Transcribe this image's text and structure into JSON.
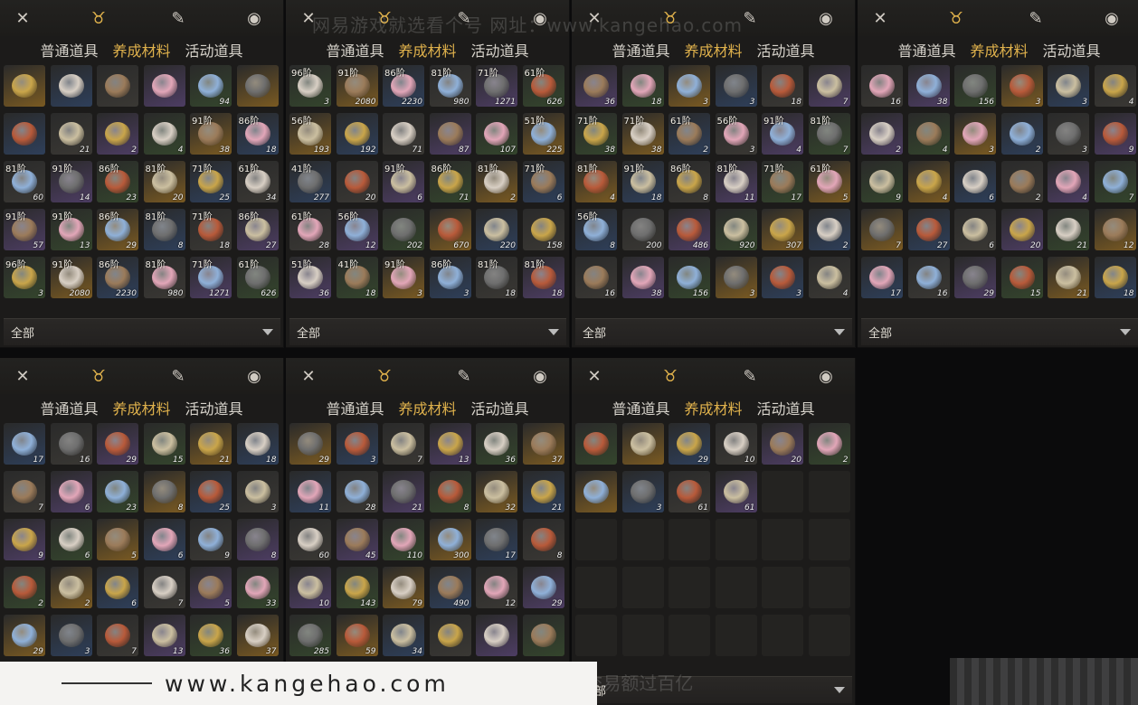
{
  "tabs_categories": [
    "普通道具",
    "养成材料",
    "活动道具"
  ],
  "active_category": "养成材料",
  "filter_label": "全部",
  "watermark_top": "网易游戏就选看个号  网址：www.kangehao.com",
  "watermark_bottom": "看个号专业网易游戏八年   年交易额过百亿",
  "banner_url": "www.kangehao.com",
  "top_icons": [
    "crossed-swords-icon",
    "pouch-icon",
    "scroll-icon",
    "location-pin-icon"
  ],
  "panels": [
    {
      "cells": [
        {
          "r": "",
          "q": ""
        },
        {
          "r": "",
          "q": ""
        },
        {
          "r": "",
          "q": ""
        },
        {
          "r": "",
          "q": ""
        },
        {
          "r": "",
          "q": "94"
        },
        {
          "r": "",
          "q": ""
        },
        {
          "r": "",
          "q": ""
        },
        {
          "r": "",
          "q": "21"
        },
        {
          "r": "",
          "q": "2"
        },
        {
          "r": "",
          "q": "4"
        },
        {
          "r": "91阶",
          "q": "38"
        },
        {
          "r": "86阶",
          "q": "18"
        },
        {
          "r": "81阶",
          "q": "60"
        },
        {
          "r": "91阶",
          "q": "14"
        },
        {
          "r": "86阶",
          "q": "23"
        },
        {
          "r": "81阶",
          "q": "20"
        },
        {
          "r": "71阶",
          "q": "25"
        },
        {
          "r": "61阶",
          "q": "34"
        },
        {
          "r": "91阶",
          "q": "57"
        },
        {
          "r": "91阶",
          "q": "13"
        },
        {
          "r": "86阶",
          "q": "29"
        },
        {
          "r": "81阶",
          "q": "8"
        },
        {
          "r": "71阶",
          "q": "18"
        },
        {
          "r": "86阶",
          "q": "27"
        },
        {
          "r": "96阶",
          "q": "3"
        },
        {
          "r": "91阶",
          "q": "2080"
        },
        {
          "r": "86阶",
          "q": "2230"
        },
        {
          "r": "81阶",
          "q": "980"
        },
        {
          "r": "71阶",
          "q": "1271"
        },
        {
          "r": "61阶",
          "q": "626"
        }
      ]
    },
    {
      "cells": [
        {
          "r": "96阶",
          "q": "3"
        },
        {
          "r": "91阶",
          "q": "2080"
        },
        {
          "r": "86阶",
          "q": "2230"
        },
        {
          "r": "81阶",
          "q": "980"
        },
        {
          "r": "71阶",
          "q": "1271"
        },
        {
          "r": "61阶",
          "q": "626"
        },
        {
          "r": "56阶",
          "q": "193"
        },
        {
          "r": "",
          "q": "192"
        },
        {
          "r": "",
          "q": "71"
        },
        {
          "r": "",
          "q": "87"
        },
        {
          "r": "",
          "q": "107"
        },
        {
          "r": "51阶",
          "q": "225"
        },
        {
          "r": "41阶",
          "q": "277"
        },
        {
          "r": "",
          "q": "20"
        },
        {
          "r": "91阶",
          "q": "6"
        },
        {
          "r": "86阶",
          "q": "71"
        },
        {
          "r": "81阶",
          "q": "2"
        },
        {
          "r": "71阶",
          "q": "6"
        },
        {
          "r": "61阶",
          "q": "28"
        },
        {
          "r": "56阶",
          "q": "12"
        },
        {
          "r": "",
          "q": "202"
        },
        {
          "r": "",
          "q": "670"
        },
        {
          "r": "",
          "q": "220"
        },
        {
          "r": "",
          "q": "158"
        },
        {
          "r": "51阶",
          "q": "36"
        },
        {
          "r": "41阶",
          "q": "18"
        },
        {
          "r": "91阶",
          "q": "3"
        },
        {
          "r": "86阶",
          "q": "3"
        },
        {
          "r": "81阶",
          "q": "18"
        },
        {
          "r": "81阶",
          "q": "18"
        }
      ]
    },
    {
      "cells": [
        {
          "r": "",
          "q": "36"
        },
        {
          "r": "",
          "q": "18"
        },
        {
          "r": "",
          "q": "3"
        },
        {
          "r": "",
          "q": "3"
        },
        {
          "r": "",
          "q": "18"
        },
        {
          "r": "",
          "q": "7"
        },
        {
          "r": "71阶",
          "q": "38"
        },
        {
          "r": "71阶",
          "q": "38"
        },
        {
          "r": "61阶",
          "q": "2"
        },
        {
          "r": "56阶",
          "q": "3"
        },
        {
          "r": "91阶",
          "q": "4"
        },
        {
          "r": "81阶",
          "q": "7"
        },
        {
          "r": "81阶",
          "q": "4"
        },
        {
          "r": "91阶",
          "q": "18"
        },
        {
          "r": "86阶",
          "q": "8"
        },
        {
          "r": "81阶",
          "q": "11"
        },
        {
          "r": "71阶",
          "q": "17"
        },
        {
          "r": "61阶",
          "q": "5"
        },
        {
          "r": "56阶",
          "q": "8"
        },
        {
          "r": "",
          "q": "200"
        },
        {
          "r": "",
          "q": "486"
        },
        {
          "r": "",
          "q": "920"
        },
        {
          "r": "",
          "q": "307"
        },
        {
          "r": "",
          "q": "2"
        },
        {
          "r": "",
          "q": "16"
        },
        {
          "r": "",
          "q": "38"
        },
        {
          "r": "",
          "q": "156"
        },
        {
          "r": "",
          "q": "3"
        },
        {
          "r": "",
          "q": "3"
        },
        {
          "r": "",
          "q": "4"
        }
      ]
    },
    {
      "cells": [
        {
          "r": "",
          "q": "16"
        },
        {
          "r": "",
          "q": "38"
        },
        {
          "r": "",
          "q": "156"
        },
        {
          "r": "",
          "q": "3"
        },
        {
          "r": "",
          "q": "3"
        },
        {
          "r": "",
          "q": "4"
        },
        {
          "r": "",
          "q": "2"
        },
        {
          "r": "",
          "q": "4"
        },
        {
          "r": "",
          "q": "3"
        },
        {
          "r": "",
          "q": "2"
        },
        {
          "r": "",
          "q": "3"
        },
        {
          "r": "",
          "q": "9"
        },
        {
          "r": "",
          "q": "9"
        },
        {
          "r": "",
          "q": "4"
        },
        {
          "r": "",
          "q": "6"
        },
        {
          "r": "",
          "q": "2"
        },
        {
          "r": "",
          "q": "4"
        },
        {
          "r": "",
          "q": "7"
        },
        {
          "r": "",
          "q": "7"
        },
        {
          "r": "",
          "q": "27"
        },
        {
          "r": "",
          "q": "6"
        },
        {
          "r": "",
          "q": "20"
        },
        {
          "r": "",
          "q": "21"
        },
        {
          "r": "",
          "q": "12"
        },
        {
          "r": "",
          "q": "17"
        },
        {
          "r": "",
          "q": "16"
        },
        {
          "r": "",
          "q": "29"
        },
        {
          "r": "",
          "q": "15"
        },
        {
          "r": "",
          "q": "21"
        },
        {
          "r": "",
          "q": "18"
        }
      ]
    },
    {
      "cells": [
        {
          "r": "",
          "q": "17"
        },
        {
          "r": "",
          "q": "16"
        },
        {
          "r": "",
          "q": "29"
        },
        {
          "r": "",
          "q": "15"
        },
        {
          "r": "",
          "q": "21"
        },
        {
          "r": "",
          "q": "18"
        },
        {
          "r": "",
          "q": "7"
        },
        {
          "r": "",
          "q": "6"
        },
        {
          "r": "",
          "q": "23"
        },
        {
          "r": "",
          "q": "8"
        },
        {
          "r": "",
          "q": "25"
        },
        {
          "r": "",
          "q": "3"
        },
        {
          "r": "",
          "q": "9"
        },
        {
          "r": "",
          "q": "6"
        },
        {
          "r": "",
          "q": "5"
        },
        {
          "r": "",
          "q": "6"
        },
        {
          "r": "",
          "q": "9"
        },
        {
          "r": "",
          "q": "8"
        },
        {
          "r": "",
          "q": "2"
        },
        {
          "r": "",
          "q": "2"
        },
        {
          "r": "",
          "q": "6"
        },
        {
          "r": "",
          "q": "7"
        },
        {
          "r": "",
          "q": "5"
        },
        {
          "r": "",
          "q": "33"
        },
        {
          "r": "",
          "q": "29"
        },
        {
          "r": "",
          "q": "3"
        },
        {
          "r": "",
          "q": "7"
        },
        {
          "r": "",
          "q": "13"
        },
        {
          "r": "",
          "q": "36"
        },
        {
          "r": "",
          "q": "37"
        }
      ]
    },
    {
      "cells": [
        {
          "r": "",
          "q": "29"
        },
        {
          "r": "",
          "q": "3"
        },
        {
          "r": "",
          "q": "7"
        },
        {
          "r": "",
          "q": "13"
        },
        {
          "r": "",
          "q": "36"
        },
        {
          "r": "",
          "q": "37"
        },
        {
          "r": "",
          "q": "11"
        },
        {
          "r": "",
          "q": "28"
        },
        {
          "r": "",
          "q": "21"
        },
        {
          "r": "",
          "q": "8"
        },
        {
          "r": "",
          "q": "32"
        },
        {
          "r": "",
          "q": "21"
        },
        {
          "r": "",
          "q": "60"
        },
        {
          "r": "",
          "q": "45"
        },
        {
          "r": "",
          "q": "110"
        },
        {
          "r": "",
          "q": "300"
        },
        {
          "r": "",
          "q": "17"
        },
        {
          "r": "",
          "q": "8"
        },
        {
          "r": "",
          "q": "10"
        },
        {
          "r": "",
          "q": "143"
        },
        {
          "r": "",
          "q": "79"
        },
        {
          "r": "",
          "q": "490"
        },
        {
          "r": "",
          "q": "12"
        },
        {
          "r": "",
          "q": "29"
        },
        {
          "r": "",
          "q": "285"
        },
        {
          "r": "",
          "q": "59"
        },
        {
          "r": "",
          "q": "34"
        },
        {
          "r": "",
          "q": ""
        },
        {
          "r": "",
          "q": ""
        },
        {
          "r": "",
          "q": ""
        }
      ]
    },
    {
      "cells": [
        {
          "r": "",
          "q": ""
        },
        {
          "r": "",
          "q": ""
        },
        {
          "r": "",
          "q": "29"
        },
        {
          "r": "",
          "q": "10"
        },
        {
          "r": "",
          "q": "20"
        },
        {
          "r": "",
          "q": "2"
        },
        {
          "r": "",
          "q": ""
        },
        {
          "r": "",
          "q": "3"
        },
        {
          "r": "",
          "q": "61"
        },
        {
          "r": "",
          "q": "61"
        },
        {
          "r": "",
          "q": ""
        },
        {
          "r": "",
          "q": ""
        },
        {
          "r": "",
          "q": ""
        },
        {
          "r": "",
          "q": ""
        },
        {
          "r": "",
          "q": ""
        },
        {
          "r": "",
          "q": ""
        },
        {
          "r": "",
          "q": ""
        },
        {
          "r": "",
          "q": ""
        },
        {
          "r": "",
          "q": ""
        },
        {
          "r": "",
          "q": ""
        },
        {
          "r": "",
          "q": ""
        },
        {
          "r": "",
          "q": ""
        },
        {
          "r": "",
          "q": ""
        },
        {
          "r": "",
          "q": ""
        },
        {
          "r": "",
          "q": ""
        },
        {
          "r": "",
          "q": ""
        },
        {
          "r": "",
          "q": ""
        },
        {
          "r": "",
          "q": ""
        },
        {
          "r": "",
          "q": ""
        },
        {
          "r": "",
          "q": ""
        }
      ]
    }
  ],
  "rarity_colors": {
    "gold": "#7a5a22",
    "purple": "#4d3d63",
    "blue": "#2e3f5a",
    "green": "#34452c",
    "grey": "#3a3834",
    "empty": "#242321"
  }
}
